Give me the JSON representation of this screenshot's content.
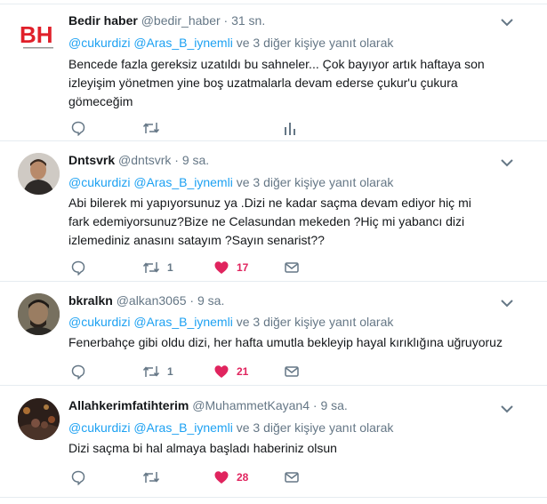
{
  "tweets": [
    {
      "name": "Bedir haber",
      "handle": "@bedir_haber",
      "time": "31 sn.",
      "avatar_text": "BH",
      "reply_handles": "@cukurdizi @Aras_B_iynemli",
      "reply_suffix": "ve 3 diğer kişiye yanıt olarak",
      "text": "Bencede fazla gereksiz uzatıldı bu sahneler... Çok bayıyor artık haftaya son izleyişim yönetmen yine boş uzatmalarla devam ederse çukur'u çukura gömeceğim",
      "retweets": "",
      "likes": "",
      "liked": false
    },
    {
      "name": "Dntsvrk",
      "handle": "@dntsvrk",
      "time": "9 sa.",
      "reply_handles": "@cukurdizi @Aras_B_iynemli",
      "reply_suffix": "ve 3 diğer kişiye yanıt olarak",
      "text": "Abi bilerek mi yapıyorsunuz ya .Dizi ne kadar saçma devam ediyor hiç mi fark edemiyorsunuz?Bize ne Celasundan mekeden ?Hiç mi yabancı dizi izlemediniz anasını satayım ?Sayın senarist??",
      "retweets": "1",
      "likes": "17",
      "liked": true
    },
    {
      "name": "bkralkn",
      "handle": "@alkan3065",
      "time": "9 sa.",
      "reply_handles": "@cukurdizi @Aras_B_iynemli",
      "reply_suffix": "ve 3 diğer kişiye yanıt olarak",
      "text": "Fenerbahçe gibi oldu dizi, her hafta umutla bekleyip hayal kırıklığına uğruyoruz",
      "retweets": "1",
      "likes": "21",
      "liked": true
    },
    {
      "name": "Allahkerimfatihterim",
      "handle": "@MuhammetKayan4",
      "time": "9 sa.",
      "reply_handles": "@cukurdizi @Aras_B_iynemli",
      "reply_suffix": "ve 3 diğer kişiye yanıt olarak",
      "text": "Dizi saçma bi hal almaya başladı haberiniz olsun",
      "retweets": "",
      "likes": "28",
      "liked": true
    }
  ],
  "colors": {
    "like_active": "#e0245e",
    "link": "#1da1f2",
    "muted": "#657786"
  },
  "icons": [
    "reply-icon",
    "retweet-icon",
    "like-icon",
    "dm-icon",
    "analytics-icon",
    "chevron-down-icon"
  ]
}
